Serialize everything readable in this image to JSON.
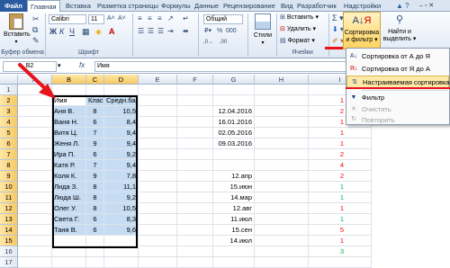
{
  "tabs": {
    "file": "Файл",
    "items": [
      "Главная",
      "Вставка",
      "Разметка страницы",
      "Формулы",
      "Данные",
      "Рецензирование",
      "Вид",
      "Разработчик",
      "Надстройки"
    ],
    "active": "Главная"
  },
  "ribbon": {
    "paste_label": "Вставить",
    "font_name": "Calibri",
    "font_size": "11",
    "number_format": "Общий",
    "styles_label": "Стили",
    "insert_label": "Вставить",
    "delete_label": "Удалить",
    "format_label": "Формат",
    "sort_filter_label_line1": "Сортировка",
    "sort_filter_label_line2": "и фильтр",
    "find_label_line1": "Найти и",
    "find_label_line2": "выделить",
    "bold": "Ж",
    "italic": "К",
    "underline": "Ч",
    "groups": {
      "clipboard": "Буфер обмена",
      "font": "Шрифт",
      "cells": "Ячейки"
    }
  },
  "formula_bar": {
    "name_box": "B2",
    "fx": "fx",
    "value": "Имя"
  },
  "columns": [
    "A",
    "B",
    "C",
    "D",
    "E",
    "F",
    "G",
    "H",
    "I"
  ],
  "rows": [
    "1",
    "2",
    "3",
    "4",
    "5",
    "6",
    "7",
    "8",
    "9",
    "10",
    "11",
    "12",
    "13",
    "14",
    "15",
    "16",
    "17"
  ],
  "table": {
    "header": [
      "Имя",
      "Класс",
      "Средн.бал"
    ],
    "data": [
      [
        "Аня В.",
        "8",
        "10,5"
      ],
      [
        "Ваня Н.",
        "6",
        "8,4"
      ],
      [
        "Витя Ц.",
        "7",
        "9,4"
      ],
      [
        "Женя Л.",
        "9",
        "9,4"
      ],
      [
        "Ира П.",
        "6",
        "9,2"
      ],
      [
        "Катя Р.",
        "7",
        "9,4"
      ],
      [
        "Коля К.",
        "9",
        "7,8"
      ],
      [
        "Лида З.",
        "8",
        "11,1"
      ],
      [
        "Люда Ш.",
        "8",
        "9,2"
      ],
      [
        "Олег У.",
        "8",
        "10,5"
      ],
      [
        "Света Г.",
        "6",
        "8,3"
      ],
      [
        "Таня В.",
        "6",
        "9,6"
      ]
    ]
  },
  "col_g": [
    "12.04.2016",
    "16.01.2016",
    "02.05.2016",
    "09.03.2016",
    "",
    "",
    "12.апр",
    "15.июн",
    "14.мар",
    "12.авг",
    "11.июл",
    "15.сен",
    "14.июл"
  ],
  "col_i": [
    {
      "v": "1",
      "color": "#ff0000"
    },
    {
      "v": "2",
      "color": "#ff0000"
    },
    {
      "v": "1",
      "color": "#ff0000"
    },
    {
      "v": "1",
      "color": "#ff0000"
    },
    {
      "v": "1",
      "color": "#ff0000"
    },
    {
      "v": "2",
      "color": "#ff0000"
    },
    {
      "v": "4",
      "color": "#ff0000"
    },
    {
      "v": "2",
      "color": "#ff0000"
    },
    {
      "v": "1",
      "color": "#00b050"
    },
    {
      "v": "1",
      "color": "#00b050"
    },
    {
      "v": "1",
      "color": "#ff0000"
    },
    {
      "v": "1",
      "color": "#00b050"
    },
    {
      "v": "5",
      "color": "#ff0000"
    },
    {
      "v": "1",
      "color": "#ff0000"
    },
    {
      "v": "3",
      "color": "#00b050"
    }
  ],
  "dropdown": {
    "items": [
      {
        "label": "Сортировка от А до Я",
        "icon": "sort-asc-icon"
      },
      {
        "label": "Сортировка от Я до А",
        "icon": "sort-desc-icon"
      },
      {
        "label": "Настраиваемая сортировка...",
        "icon": "custom-sort-icon"
      },
      {
        "label": "Фильтр",
        "icon": "filter-icon"
      },
      {
        "label": "Очистить",
        "icon": "clear-icon"
      },
      {
        "label": "Повторить",
        "icon": "reapply-icon"
      }
    ]
  },
  "colors": {
    "arrow": "#e8141c",
    "selection": "#c5dcf3",
    "menu_highlight": "#ffe9a8"
  }
}
